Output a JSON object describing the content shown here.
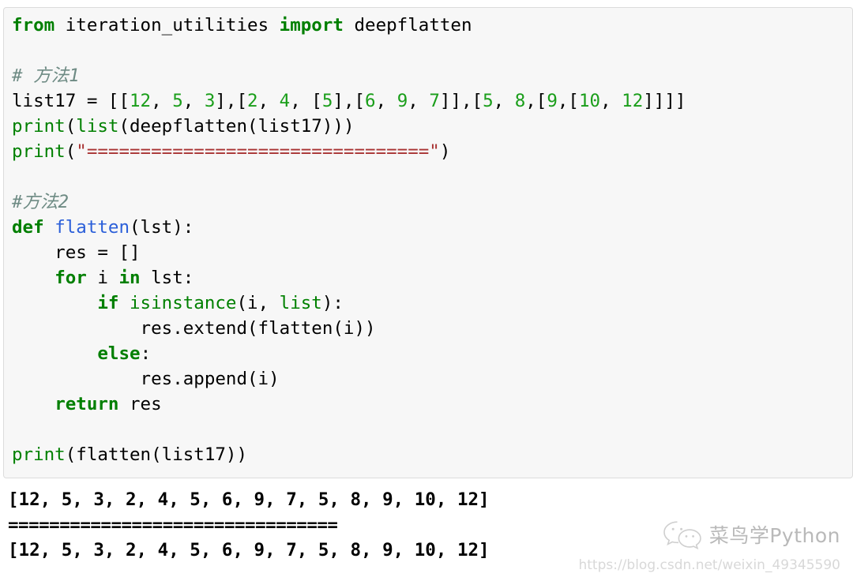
{
  "cell": {
    "kind": "jupyter-code-cell",
    "background": "#f7f7f7",
    "border_color": "#dcdcdc",
    "lines": [
      {
        "id": "l1",
        "text": "from iteration_utilities import deepflatten",
        "tokens": [
          {
            "t": "from",
            "c": "kw"
          },
          {
            "t": " iteration_utilities ",
            "c": "pl"
          },
          {
            "t": "import",
            "c": "kw"
          },
          {
            "t": " deepflatten",
            "c": "pl"
          }
        ]
      },
      {
        "id": "l2",
        "text": "",
        "tokens": []
      },
      {
        "id": "l3",
        "text": "# 方法1",
        "tokens": [
          {
            "t": "# 方法1",
            "c": "cmt"
          }
        ]
      },
      {
        "id": "l4",
        "text": "list17 = [[12, 5, 3],[2, 4, [5],[6, 9, 7]],[5, 8,[9,[10, 12]]]]",
        "tokens": [
          {
            "t": "list17 = [[",
            "c": "pl"
          },
          {
            "t": "12",
            "c": "num"
          },
          {
            "t": ", ",
            "c": "pl"
          },
          {
            "t": "5",
            "c": "num"
          },
          {
            "t": ", ",
            "c": "pl"
          },
          {
            "t": "3",
            "c": "num"
          },
          {
            "t": "],[",
            "c": "pl"
          },
          {
            "t": "2",
            "c": "num"
          },
          {
            "t": ", ",
            "c": "pl"
          },
          {
            "t": "4",
            "c": "num"
          },
          {
            "t": ", [",
            "c": "pl"
          },
          {
            "t": "5",
            "c": "num"
          },
          {
            "t": "],[",
            "c": "pl"
          },
          {
            "t": "6",
            "c": "num"
          },
          {
            "t": ", ",
            "c": "pl"
          },
          {
            "t": "9",
            "c": "num"
          },
          {
            "t": ", ",
            "c": "pl"
          },
          {
            "t": "7",
            "c": "num"
          },
          {
            "t": "]],[",
            "c": "pl"
          },
          {
            "t": "5",
            "c": "num"
          },
          {
            "t": ", ",
            "c": "pl"
          },
          {
            "t": "8",
            "c": "num"
          },
          {
            "t": ",[",
            "c": "pl"
          },
          {
            "t": "9",
            "c": "num"
          },
          {
            "t": ",[",
            "c": "pl"
          },
          {
            "t": "10",
            "c": "num"
          },
          {
            "t": ", ",
            "c": "pl"
          },
          {
            "t": "12",
            "c": "num"
          },
          {
            "t": "]]]]",
            "c": "pl"
          }
        ]
      },
      {
        "id": "l5",
        "text": "print(list(deepflatten(list17)))",
        "tokens": [
          {
            "t": "print",
            "c": "bi"
          },
          {
            "t": "(",
            "c": "pl"
          },
          {
            "t": "list",
            "c": "bi"
          },
          {
            "t": "(deepflatten(list17)))",
            "c": "pl"
          }
        ]
      },
      {
        "id": "l6",
        "text": "print(\"================================\")",
        "tokens": [
          {
            "t": "print",
            "c": "bi"
          },
          {
            "t": "(",
            "c": "pl"
          },
          {
            "t": "\"================================\"",
            "c": "str"
          },
          {
            "t": ")",
            "c": "pl"
          }
        ]
      },
      {
        "id": "l7",
        "text": "",
        "tokens": []
      },
      {
        "id": "l8",
        "text": "#方法2",
        "tokens": [
          {
            "t": "#方法2",
            "c": "cmt"
          }
        ]
      },
      {
        "id": "l9",
        "text": "def flatten(lst):",
        "tokens": [
          {
            "t": "def",
            "c": "kw"
          },
          {
            "t": " ",
            "c": "pl"
          },
          {
            "t": "flatten",
            "c": "fn"
          },
          {
            "t": "(lst):",
            "c": "pl"
          }
        ]
      },
      {
        "id": "l10",
        "text": "    res = []",
        "tokens": [
          {
            "t": "    res = []",
            "c": "pl"
          }
        ]
      },
      {
        "id": "l11",
        "text": "    for i in lst:",
        "tokens": [
          {
            "t": "    ",
            "c": "pl"
          },
          {
            "t": "for",
            "c": "kw"
          },
          {
            "t": " i ",
            "c": "pl"
          },
          {
            "t": "in",
            "c": "kw"
          },
          {
            "t": " lst:",
            "c": "pl"
          }
        ]
      },
      {
        "id": "l12",
        "text": "        if isinstance(i, list):",
        "tokens": [
          {
            "t": "        ",
            "c": "pl"
          },
          {
            "t": "if",
            "c": "kw"
          },
          {
            "t": " ",
            "c": "pl"
          },
          {
            "t": "isinstance",
            "c": "bi"
          },
          {
            "t": "(i, ",
            "c": "pl"
          },
          {
            "t": "list",
            "c": "bi"
          },
          {
            "t": "):",
            "c": "pl"
          }
        ]
      },
      {
        "id": "l13",
        "text": "            res.extend(flatten(i))",
        "tokens": [
          {
            "t": "            res.extend(flatten(i))",
            "c": "pl"
          }
        ]
      },
      {
        "id": "l14",
        "text": "        else:",
        "tokens": [
          {
            "t": "        ",
            "c": "pl"
          },
          {
            "t": "else",
            "c": "kw"
          },
          {
            "t": ":",
            "c": "pl"
          }
        ]
      },
      {
        "id": "l15",
        "text": "            res.append(i)",
        "tokens": [
          {
            "t": "            res.append(i)",
            "c": "pl"
          }
        ]
      },
      {
        "id": "l16",
        "text": "    return res",
        "tokens": [
          {
            "t": "    ",
            "c": "pl"
          },
          {
            "t": "return",
            "c": "kw"
          },
          {
            "t": " res",
            "c": "pl"
          }
        ]
      },
      {
        "id": "l17",
        "text": "",
        "tokens": []
      },
      {
        "id": "l18",
        "text": "print(flatten(list17))",
        "tokens": [
          {
            "t": "print",
            "c": "bi"
          },
          {
            "t": "(flatten(list17))",
            "c": "pl"
          }
        ]
      }
    ]
  },
  "output": {
    "lines": [
      "[12, 5, 3, 2, 4, 5, 6, 9, 7, 5, 8, 9, 10, 12]",
      "================================",
      "[12, 5, 3, 2, 4, 5, 6, 9, 7, 5, 8, 9, 10, 12]"
    ]
  },
  "watermark": {
    "brand": "菜鸟学Python",
    "url": "https://blog.csdn.net/weixin_49345590",
    "logo": "wechat-icon",
    "brand_color": "#b9b9b9",
    "url_color": "#d8d8d8"
  }
}
